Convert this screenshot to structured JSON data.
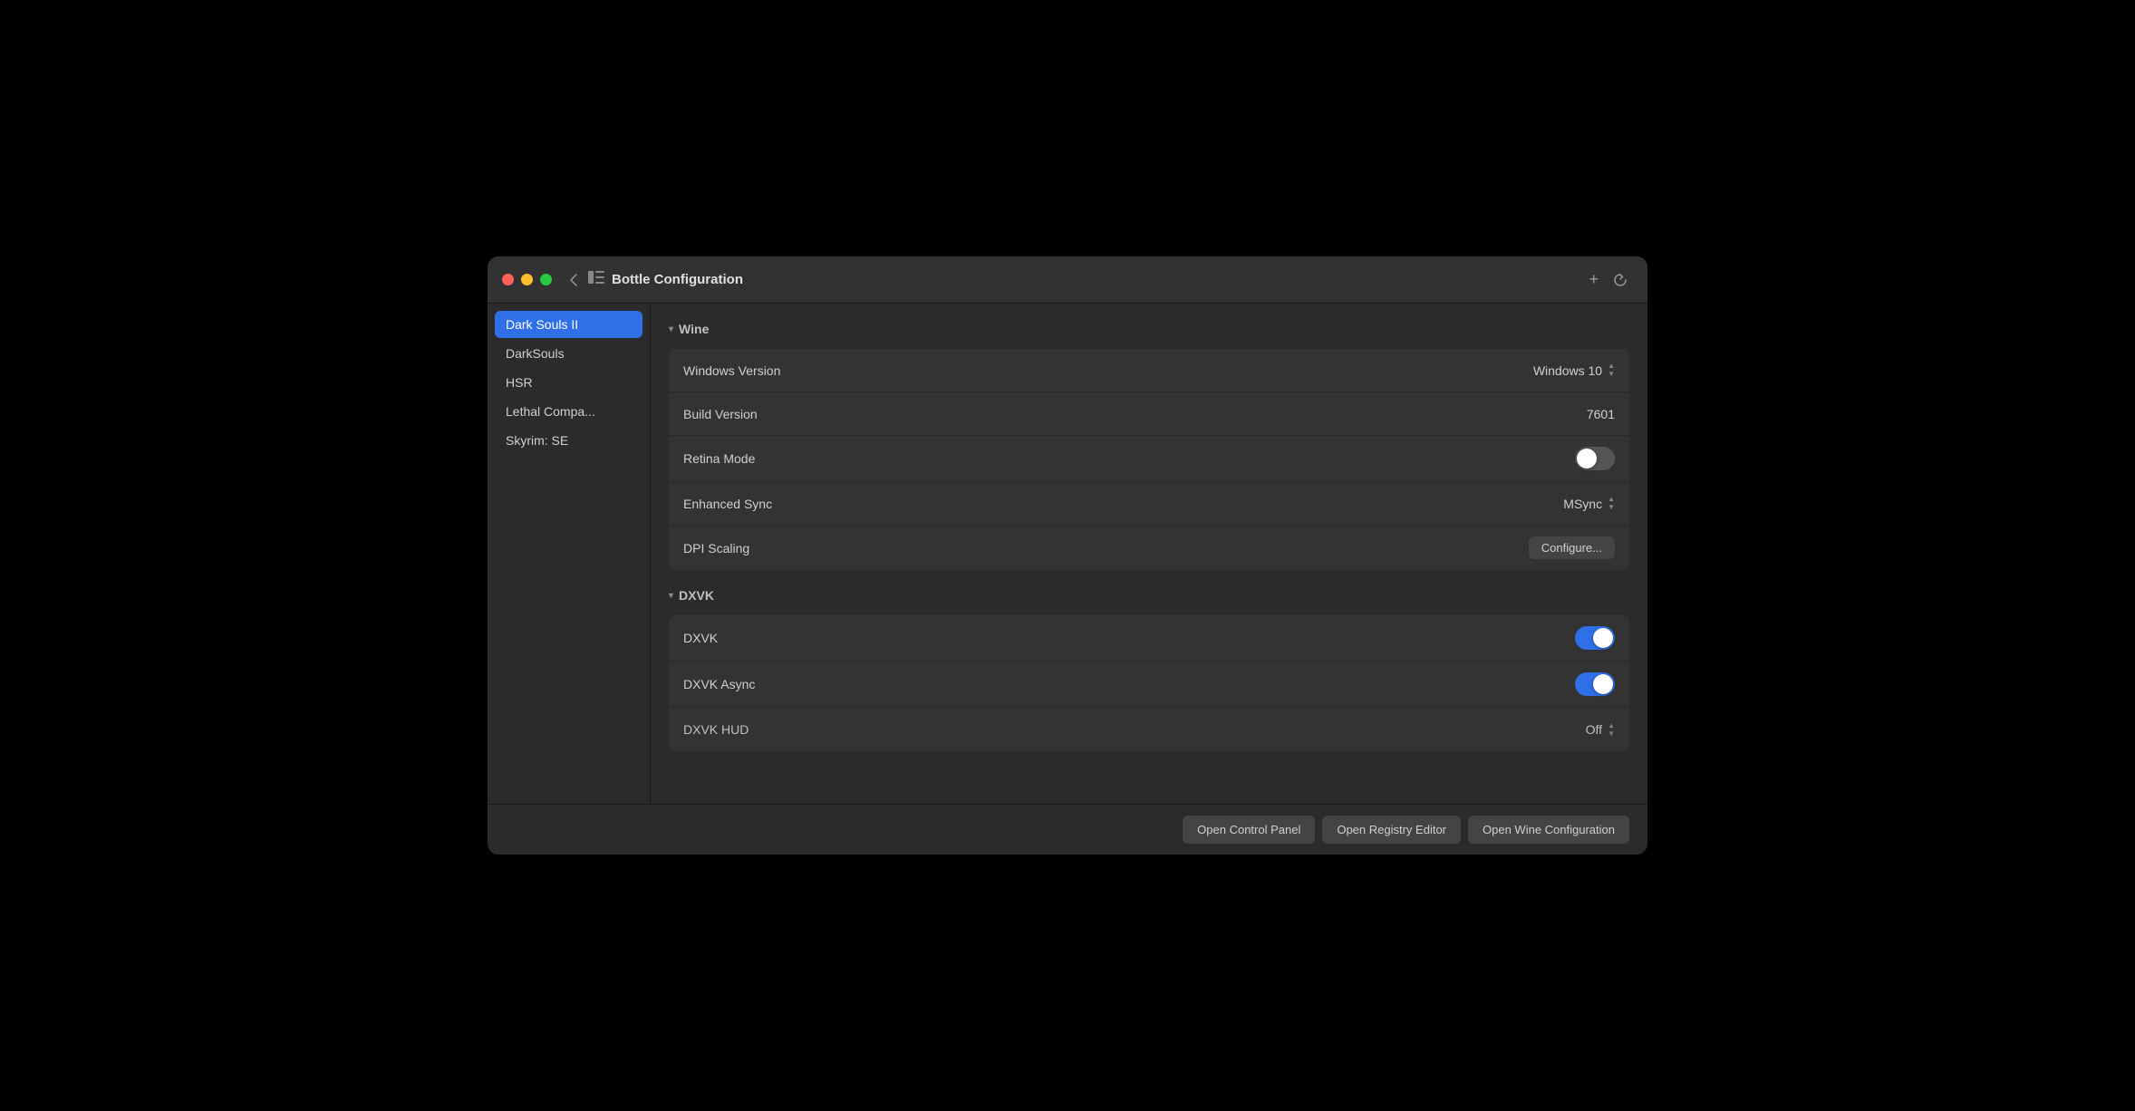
{
  "window": {
    "title": "Bottle Configuration"
  },
  "sidebar": {
    "items": [
      {
        "id": "dark-souls-2",
        "label": "Dark Souls II",
        "active": true
      },
      {
        "id": "dark-souls",
        "label": "DarkSouls",
        "active": false
      },
      {
        "id": "hsr",
        "label": "HSR",
        "active": false
      },
      {
        "id": "lethal-company",
        "label": "Lethal Compa...",
        "active": false
      },
      {
        "id": "skyrim-se",
        "label": "Skyrim: SE",
        "active": false
      }
    ]
  },
  "sections": {
    "wine": {
      "header": "Wine",
      "settings": {
        "windows_version": {
          "label": "Windows Version",
          "value": "Windows 10"
        },
        "build_version": {
          "label": "Build Version",
          "value": "7601"
        },
        "retina_mode": {
          "label": "Retina Mode",
          "enabled": false
        },
        "enhanced_sync": {
          "label": "Enhanced Sync",
          "value": "MSync"
        },
        "dpi_scaling": {
          "label": "DPI Scaling",
          "button": "Configure..."
        }
      }
    },
    "dxvk": {
      "header": "DXVK",
      "settings": {
        "dxvk": {
          "label": "DXVK",
          "enabled": true
        },
        "dxvk_async": {
          "label": "DXVK Async",
          "enabled": true
        },
        "dxvk_hud": {
          "label": "DXVK HUD",
          "value": "Off"
        }
      }
    }
  },
  "footer": {
    "buttons": [
      {
        "id": "open-control-panel",
        "label": "Open Control Panel"
      },
      {
        "id": "open-registry-editor",
        "label": "Open Registry Editor"
      },
      {
        "id": "open-wine-configuration",
        "label": "Open Wine Configuration"
      }
    ]
  },
  "icons": {
    "back": "‹",
    "sidebar_toggle": "⊞",
    "add": "+",
    "refresh": "↻",
    "chevron_down": "▾"
  }
}
